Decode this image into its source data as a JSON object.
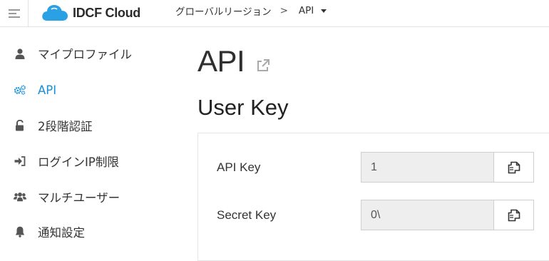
{
  "header": {
    "brand": "IDCF Cloud",
    "region": "グローバルリージョン",
    "separator": ">",
    "service": "API"
  },
  "sidebar": {
    "items": [
      {
        "label": "マイプロファイル",
        "icon": "user-icon",
        "active": false
      },
      {
        "label": "API",
        "icon": "gears-icon",
        "active": true
      },
      {
        "label": "2段階認証",
        "icon": "unlock-icon",
        "active": false
      },
      {
        "label": "ログインIP制限",
        "icon": "sign-in-icon",
        "active": false
      },
      {
        "label": "マルチユーザー",
        "icon": "users-icon",
        "active": false
      },
      {
        "label": "通知設定",
        "icon": "bell-icon",
        "active": false
      }
    ]
  },
  "main": {
    "title": "API",
    "section_title": "User Key",
    "fields": [
      {
        "label": "API Key",
        "value": "1"
      },
      {
        "label": "Secret Key",
        "value": "0\\"
      }
    ]
  },
  "colors": {
    "accent": "#1a8fd8",
    "logo": "#2aa1e4"
  }
}
